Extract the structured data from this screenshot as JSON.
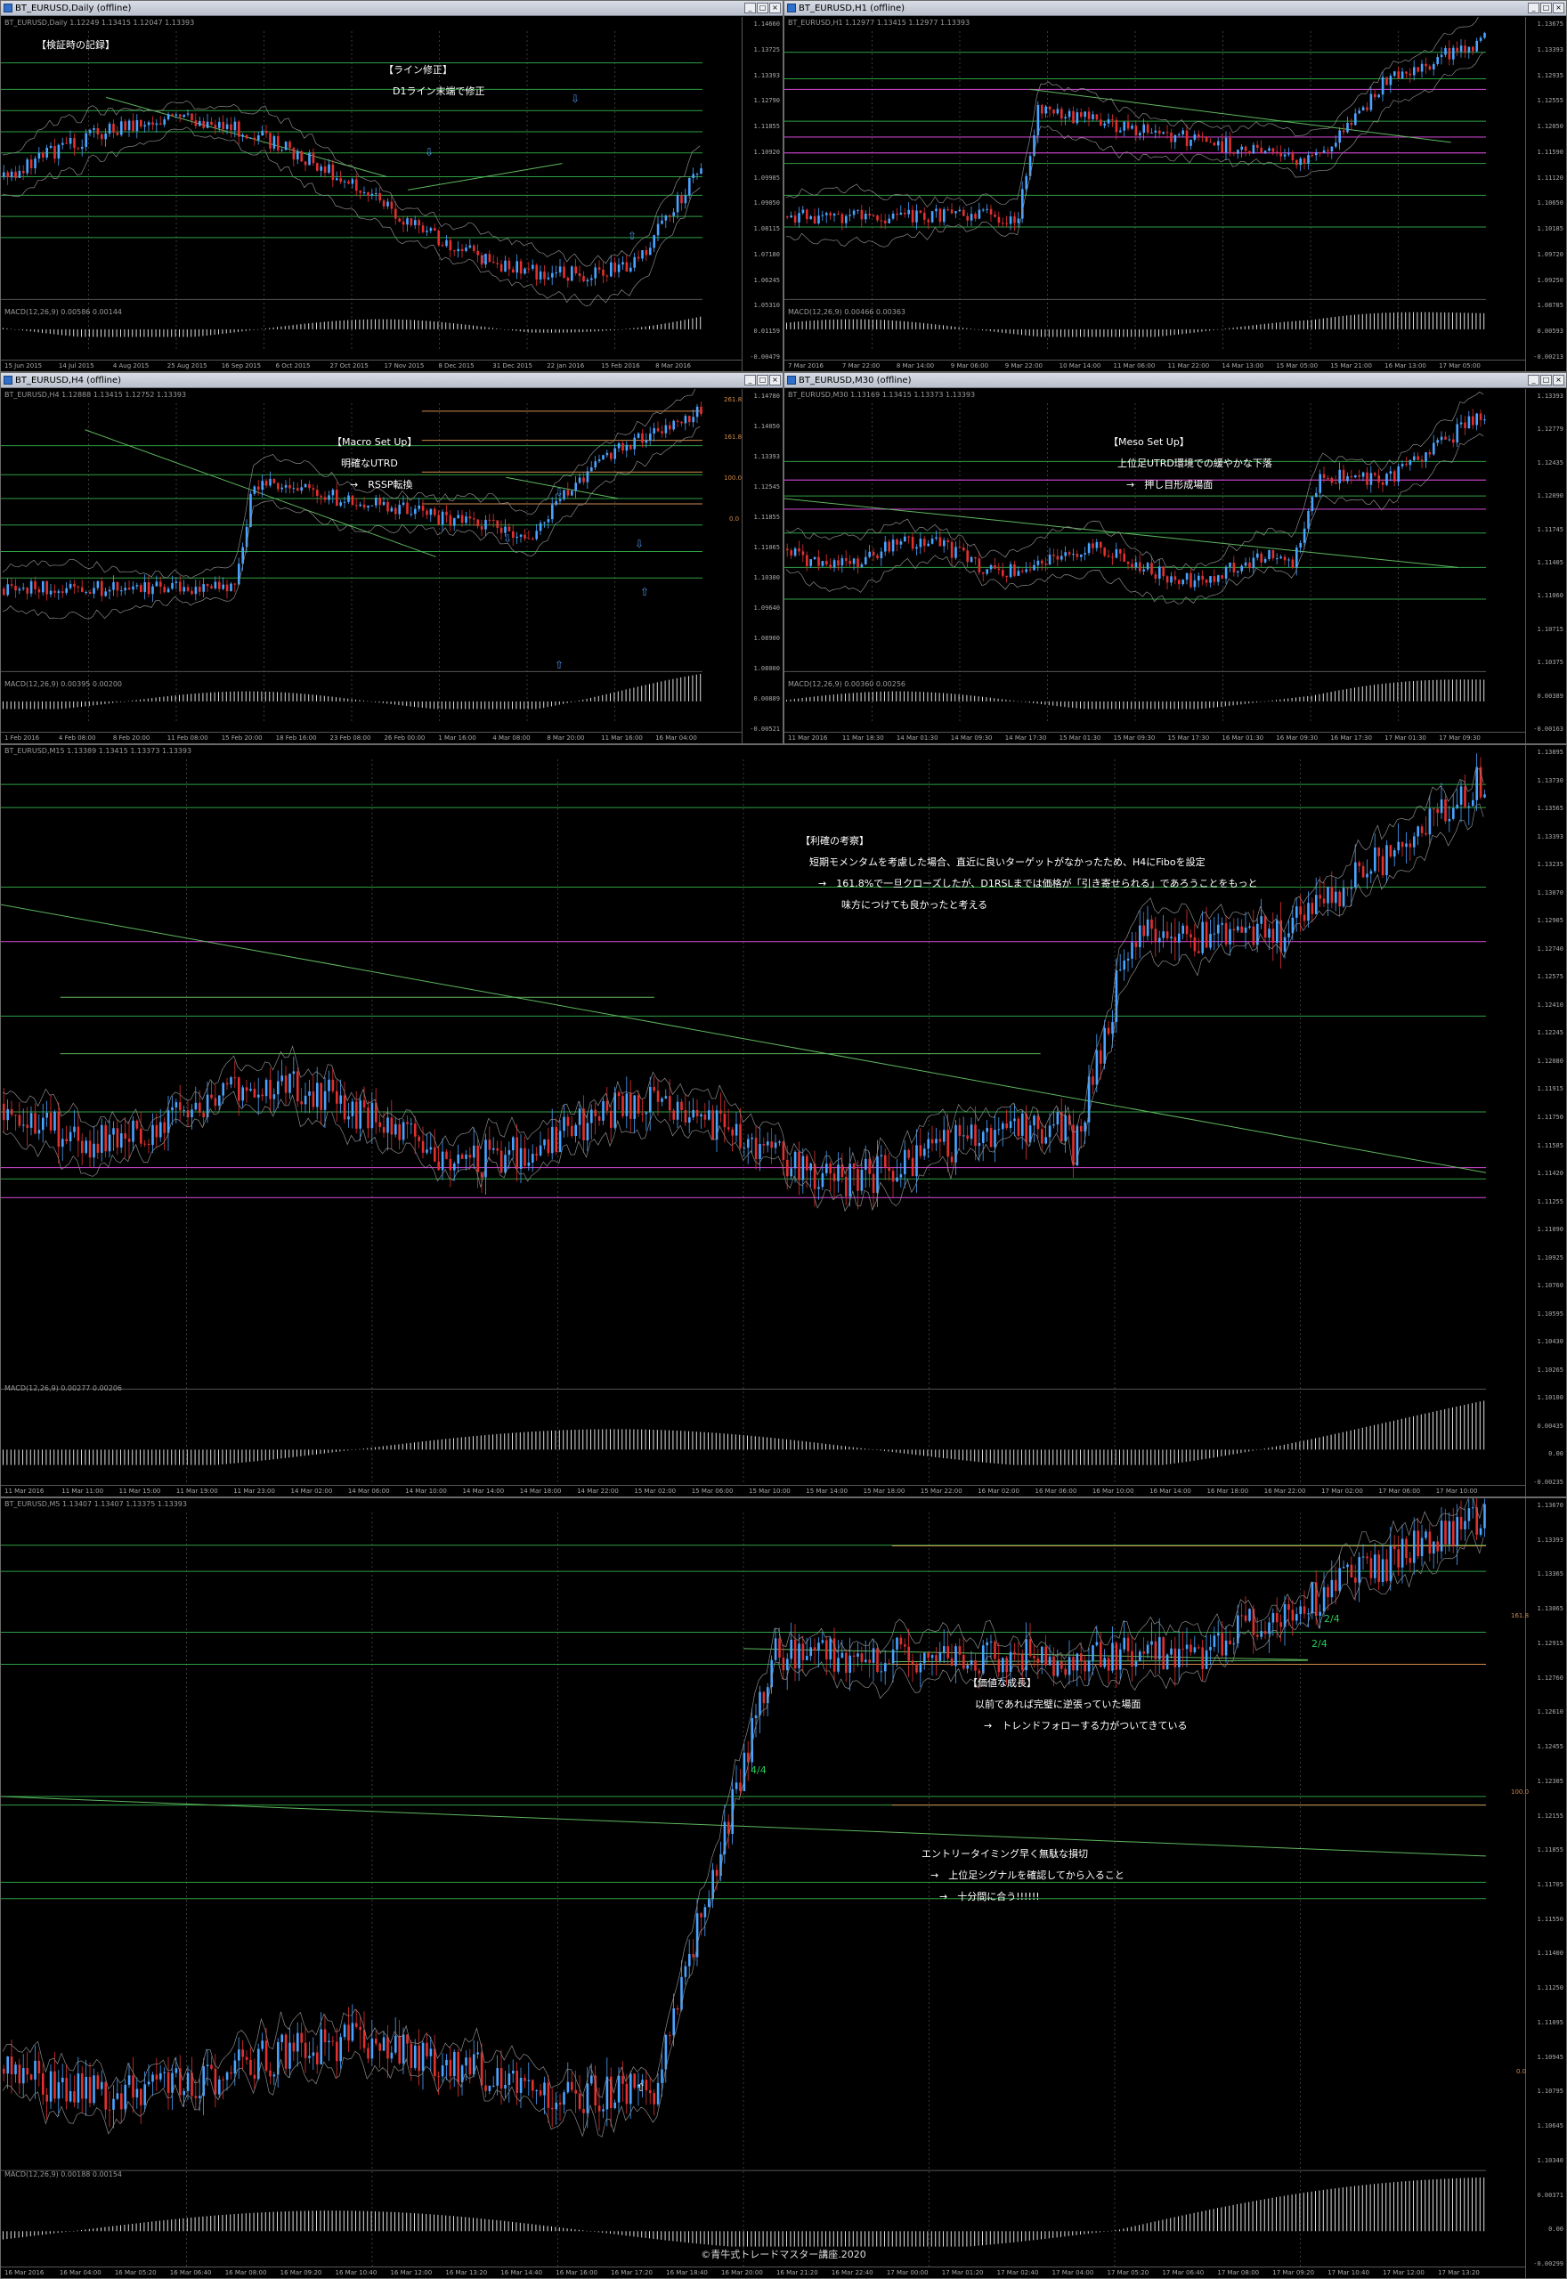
{
  "windows": {
    "daily": {
      "title": "BT_EURUSD,Daily (offline)",
      "symbol_line": "BT_EURUSD,Daily  1.12249  1.13415  1.12047  1.13393",
      "macd": "MACD(12,26,9)  0.00586  0.00144",
      "prices": [
        "1.14660",
        "1.13725",
        "1.13393",
        "1.12790",
        "1.11855",
        "1.10920",
        "1.09985",
        "1.09050",
        "1.08115",
        "1.07180",
        "1.06245",
        "1.05310",
        "0.01159",
        "-0.00479"
      ],
      "times": [
        "15 Jun 2015",
        "14 Jul 2015",
        "4 Aug 2015",
        "25 Aug 2015",
        "16 Sep 2015",
        "6 Oct 2015",
        "27 Oct 2015",
        "17 Nov 2015",
        "8 Dec 2015",
        "31 Dec 2015",
        "22 Jan 2016",
        "15 Feb 2016",
        "8 Mar 2016"
      ],
      "notes": [
        "【検証時の記録】",
        "【ライン修正】",
        "D1ライン末端で修正"
      ]
    },
    "h1": {
      "title": "BT_EURUSD,H1 (offline)",
      "symbol_line": "BT_EURUSD,H1  1.12977  1.13415  1.12977  1.13393",
      "macd": "MACD(12,26,9)  0.00466  0.00363",
      "prices": [
        "1.13675",
        "1.13393",
        "1.12935",
        "1.12555",
        "1.12050",
        "1.11590",
        "1.11120",
        "1.10650",
        "1.10185",
        "1.09720",
        "1.09250",
        "1.08785",
        "0.00593",
        "-0.00213"
      ],
      "times": [
        "7 Mar 2016",
        "7 Mar 22:00",
        "8 Mar 14:00",
        "9 Mar 06:00",
        "9 Mar 22:00",
        "10 Mar 14:00",
        "11 Mar 06:00",
        "11 Mar 22:00",
        "14 Mar 13:00",
        "15 Mar 05:00",
        "15 Mar 21:00",
        "16 Mar 13:00",
        "17 Mar 05:00"
      ]
    },
    "h4": {
      "title": "BT_EURUSD,H4 (offline)",
      "symbol_line": "BT_EURUSD,H4  1.12888  1.13415  1.12752  1.13393",
      "macd": "MACD(12,26,9)  0.00395  0.00200",
      "prices": [
        "1.14780",
        "1.14050",
        "1.13393",
        "1.12545",
        "1.11855",
        "1.11065",
        "1.10300",
        "1.09640",
        "1.08900",
        "1.08000",
        "0.00889",
        "-0.00521"
      ],
      "times": [
        "1 Feb 2016",
        "4 Feb 08:00",
        "8 Feb 20:00",
        "11 Feb 08:00",
        "15 Feb 20:00",
        "18 Feb 16:00",
        "23 Feb 08:00",
        "26 Feb 00:00",
        "1 Mar 16:00",
        "4 Mar 08:00",
        "8 Mar 20:00",
        "11 Mar 16:00",
        "16 Mar 04:00"
      ],
      "fib_labels": [
        "261.8",
        "161.8",
        "100.0",
        "0.0"
      ],
      "notes": [
        "【Macro Set Up】",
        "明確なUTRD",
        "→　RSSP転換"
      ]
    },
    "m30": {
      "title": "BT_EURUSD,M30 (offline)",
      "symbol_line": "BT_EURUSD,M30  1.13169  1.13415  1.13373  1.13393",
      "macd": "MACD(12,26,9)  0.00360  0.00256",
      "prices": [
        "1.13393",
        "1.12779",
        "1.12435",
        "1.12090",
        "1.11745",
        "1.11405",
        "1.11060",
        "1.10715",
        "1.10375",
        "0.00389",
        "-0.00163"
      ],
      "times": [
        "11 Mar 2016",
        "11 Mar 18:30",
        "14 Mar 01:30",
        "14 Mar 09:30",
        "14 Mar 17:30",
        "15 Mar 01:30",
        "15 Mar 09:30",
        "15 Mar 17:30",
        "16 Mar 01:30",
        "16 Mar 09:30",
        "16 Mar 17:30",
        "17 Mar 01:30",
        "17 Mar 09:30"
      ],
      "notes": [
        "【Meso Set Up】",
        "上位足UTRD環境での緩やかな下落",
        "→　押し目形成場面"
      ]
    },
    "m15": {
      "symbol_line": "BT_EURUSD,M15  1.13389  1.13415  1.13373  1.13393",
      "macd": "MACD(12,26,9)  0.00277  0.00206",
      "prices": [
        "1.13895",
        "1.13730",
        "1.13565",
        "1.13393",
        "1.13235",
        "1.13070",
        "1.12905",
        "1.12740",
        "1.12575",
        "1.12410",
        "1.12245",
        "1.12080",
        "1.11915",
        "1.11750",
        "1.11585",
        "1.11420",
        "1.11255",
        "1.11090",
        "1.10925",
        "1.10760",
        "1.10595",
        "1.10430",
        "1.10265",
        "1.10100",
        "0.00435",
        "0.00",
        "-0.00235"
      ],
      "times": [
        "11 Mar 2016",
        "11 Mar 11:00",
        "11 Mar 15:00",
        "11 Mar 19:00",
        "11 Mar 23:00",
        "14 Mar 02:00",
        "14 Mar 06:00",
        "14 Mar 10:00",
        "14 Mar 14:00",
        "14 Mar 18:00",
        "14 Mar 22:00",
        "15 Mar 02:00",
        "15 Mar 06:00",
        "15 Mar 10:00",
        "15 Mar 14:00",
        "15 Mar 18:00",
        "15 Mar 22:00",
        "16 Mar 02:00",
        "16 Mar 06:00",
        "16 Mar 10:00",
        "16 Mar 14:00",
        "16 Mar 18:00",
        "16 Mar 22:00",
        "17 Mar 02:00",
        "17 Mar 06:00",
        "17 Mar 10:00"
      ],
      "notes": [
        "【利確の考察】",
        "短期モメンタムを考慮した場合、直近に良いターゲットがなかったため、H4にFiboを設定",
        "→　161.8%で一旦クローズしたが、D1RSLまでは価格が「引き寄せられる」であろうことをもっと",
        "味方につけても良かったと考える"
      ]
    },
    "m5": {
      "symbol_line": "BT_EURUSD,M5  1.13407  1.13407  1.13375  1.13393",
      "macd": "MACD(12,26,9)  0.00188  0.00154",
      "prices": [
        "1.13670",
        "1.13393",
        "1.13365",
        "1.13065",
        "1.12915",
        "1.12760",
        "1.12610",
        "1.12455",
        "1.12305",
        "1.12155",
        "1.11855",
        "1.11705",
        "1.11550",
        "1.11400",
        "1.11250",
        "1.11095",
        "1.10945",
        "1.10795",
        "1.10645",
        "1.10340",
        "0.00371",
        "0.00",
        "-0.00299"
      ],
      "times": [
        "16 Mar 2016",
        "16 Mar 04:00",
        "16 Mar 05:20",
        "16 Mar 06:40",
        "16 Mar 08:00",
        "16 Mar 09:20",
        "16 Mar 10:40",
        "16 Mar 12:00",
        "16 Mar 13:20",
        "16 Mar 14:40",
        "16 Mar 16:00",
        "16 Mar 17:20",
        "16 Mar 18:40",
        "16 Mar 20:00",
        "16 Mar 21:20",
        "16 Mar 22:40",
        "17 Mar 00:00",
        "17 Mar 01:20",
        "17 Mar 02:40",
        "17 Mar 04:00",
        "17 Mar 05:20",
        "17 Mar 06:40",
        "17 Mar 08:00",
        "17 Mar 09:20",
        "17 Mar 10:40",
        "17 Mar 12:00",
        "17 Mar 13:20"
      ],
      "fib_labels": [
        "161.8",
        "100.0",
        "0.0"
      ],
      "counts": [
        "4/4",
        "2/4",
        "2/4"
      ],
      "notes_a": [
        "【価値な成長】",
        "以前であれば完璧に逆張っていた場面",
        "→　トレンドフォローする力がついてきている"
      ],
      "notes_b": [
        "エントリータイミング早く無駄な損切",
        "→　上位足シグナルを確認してから入ること",
        "→　十分間に合う!!!!!!"
      ]
    }
  },
  "buttons": {
    "minimize": "_",
    "maximize": "□",
    "close": "×"
  },
  "colors": {
    "bull": "#4aa3ff",
    "bear": "#e03030",
    "level_green": "#2ea043",
    "level_magenta": "#c040c0",
    "grid": "#3a3a3a",
    "fib": "#d08a4a"
  },
  "copyright": "©青牛式トレードマスター講座.2020"
}
